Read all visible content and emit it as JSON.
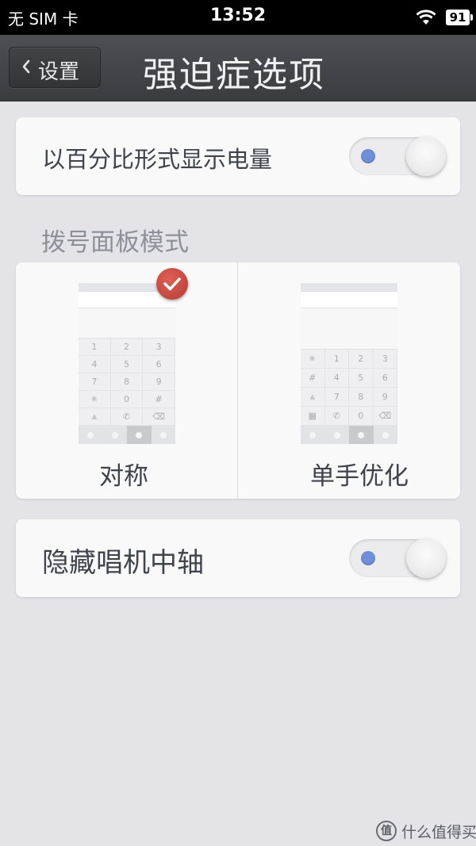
{
  "status_bar": {
    "carrier": "无 SIM 卡",
    "time": "13:52",
    "battery": "91",
    "wifi_icon": "wifi-icon"
  },
  "title_bar": {
    "back_label": "设置",
    "title": "强迫症选项"
  },
  "battery_percent_row": {
    "label": "以百分比形式显示电量",
    "toggle_on": false
  },
  "dialpad_section": {
    "header": "拨号面板模式",
    "options": [
      {
        "label": "对称",
        "selected": true,
        "columns": 3,
        "keys": [
          "1",
          "2",
          "3",
          "4",
          "5",
          "6",
          "7",
          "8",
          "9",
          "✳",
          "0",
          "#",
          "⩓",
          "✆",
          "⌫"
        ]
      },
      {
        "label": "单手优化",
        "selected": false,
        "columns": 4,
        "keys": [
          "✳",
          "1",
          "2",
          "3",
          "#",
          "4",
          "5",
          "6",
          "⩓",
          "7",
          "8",
          "9",
          "▦",
          "✆",
          "0",
          "⌫"
        ]
      }
    ]
  },
  "hide_axis_row": {
    "label": "隐藏唱机中轴",
    "toggle_on": false
  },
  "watermark": {
    "logo": "值",
    "text": "什么值得买"
  },
  "colors": {
    "accent_toggle_dot": "#6f8fd8",
    "check_badge": "#c9463d",
    "title_bar": "#414347"
  }
}
